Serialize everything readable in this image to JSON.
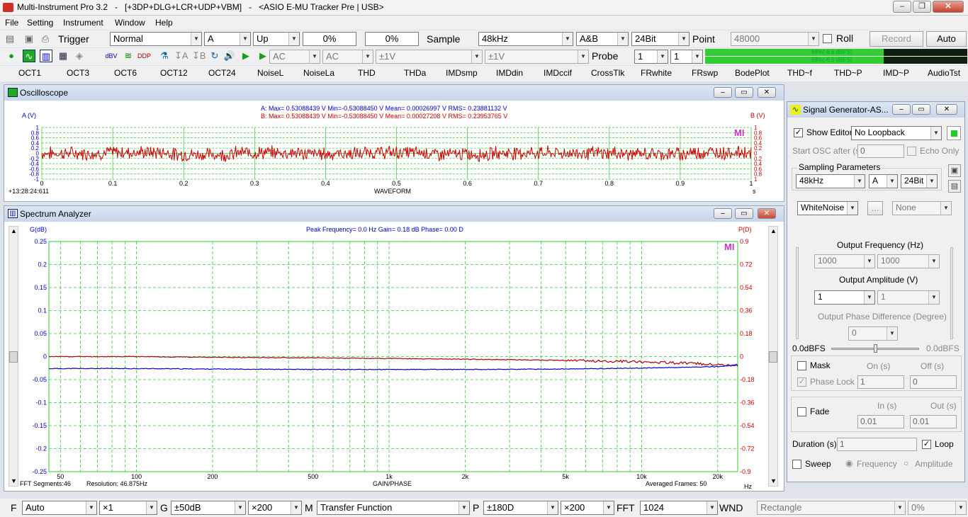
{
  "window_title": "Multi-Instrument Pro 3.2   -   [+3DP+DLG+LCR+UDP+VBM]   -   <ASIO E-MU Tracker Pre | USB>",
  "menu": [
    "File",
    "Setting",
    "Instrument",
    "Window",
    "Help"
  ],
  "toolbar1": {
    "trigger_label": "Trigger",
    "trigger_mode": "Normal",
    "channel": "A",
    "edge": "Up",
    "pct1": "0%",
    "pct2": "0%",
    "sample_label": "Sample",
    "sample_rate": "48kHz",
    "channels": "A&B",
    "bits": "24Bit",
    "point_label": "Point",
    "point_value": "48000",
    "roll_label": "Roll",
    "record_label": "Record",
    "auto_label": "Auto"
  },
  "toolbar2": {
    "coupling_a": "AC",
    "coupling_b": "AC",
    "range_a": "±1V",
    "range_b": "±1V",
    "probe_label": "Probe",
    "probe_a": "1",
    "probe_b": "1",
    "level_a": "68%(-6.6 dBFS)",
    "level_b": "68%(-6.6 dBFS)"
  },
  "function_buttons": [
    "OCT1",
    "OCT3",
    "OCT6",
    "OCT12",
    "OCT24",
    "NoiseL",
    "NoiseLa",
    "THD",
    "THDa",
    "IMDsmp",
    "IMDdin",
    "IMDccif",
    "CrossTlk",
    "FRwhite",
    "FRswp",
    "BodePlot",
    "THD~f",
    "THD~P",
    "IMD~P",
    "AudioTst"
  ],
  "oscilloscope": {
    "title": "Oscilloscope",
    "stats_a": "A:  Max= 0.53088439  V  Min=-0.53088450  V  Mean= 0.00026997  V  RMS= 0.23881132  V",
    "stats_b": "B:  Max= 0.53088439  V  Min=-0.53088450  V  Mean= 0.00027208  V  RMS= 0.23953765  V",
    "ylabel_a": "A (V)",
    "ylabel_b": "B (V)",
    "xlabel": "WAVEFORM",
    "timestamp": "+13:28:24:611",
    "x_unit": "s",
    "logo": "MI"
  },
  "spectrum": {
    "title": "Spectrum Analyzer",
    "ylabel_left": "G(dB)",
    "ylabel_right": "P(D)",
    "peak_info": "Peak Frequency= 0.0 Hz  Gain= 0.18 dB  Phase= 0.00 D",
    "xlabel": "GAIN/PHASE",
    "fft_segments": "FFT Segments:46",
    "resolution": "Resolution: 46.875Hz",
    "averaged": "Averaged Frames: 50",
    "x_unit": "Hz",
    "logo": "MI"
  },
  "chart_data": [
    {
      "type": "line",
      "title": "",
      "xlabel": "WAVEFORM",
      "ylabel": "A (V)",
      "y2label": "B (V)",
      "xlim": [
        0,
        1
      ],
      "ylim": [
        -1,
        1
      ],
      "x_ticks": [
        "0",
        "0.1",
        "0.2",
        "0.3",
        "0.4",
        "0.5",
        "0.6",
        "0.7",
        "0.8",
        "0.9",
        "1"
      ],
      "y_ticks": [
        "1",
        "0.8",
        "0.6",
        "0.4",
        "0.2",
        "0",
        "-0.2",
        "-0.4",
        "-0.6",
        "-0.8",
        "-1"
      ],
      "grid": true,
      "series": [
        {
          "name": "A",
          "color": "#0000ff",
          "values": [
            0.0,
            0.12,
            -0.15,
            0.08,
            -0.05,
            0.1,
            -0.12,
            0.06,
            0.02,
            -0.09,
            0.11,
            -0.07
          ]
        },
        {
          "name": "B",
          "color": "#cc0000",
          "values": [
            0.0,
            0.12,
            -0.15,
            0.08,
            -0.05,
            0.1,
            -0.12,
            0.06,
            0.02,
            -0.09,
            0.11,
            -0.07
          ]
        }
      ]
    },
    {
      "type": "line",
      "title": "",
      "xlabel": "GAIN/PHASE",
      "ylabel": "G(dB)",
      "y2label": "P(D)",
      "x_scale": "log",
      "xlim": [
        45,
        24000
      ],
      "ylim": [
        -0.25,
        0.25
      ],
      "y2lim": [
        -0.9,
        0.9
      ],
      "x_ticks": [
        "50",
        "100",
        "200",
        "500",
        "1k",
        "2k",
        "5k",
        "10k",
        "20k"
      ],
      "y_ticks": [
        "0.25",
        "0.2",
        "0.15",
        "0.1",
        "0.05",
        "0",
        "-0.05",
        "-0.1",
        "-0.15",
        "-0.2",
        "-0.25"
      ],
      "y2_ticks": [
        "0.9",
        "0.72",
        "0.54",
        "0.36",
        "0.18",
        "0",
        "-0.18",
        "-0.36",
        "-0.54",
        "-0.72",
        "-0.9"
      ],
      "grid": true,
      "series": [
        {
          "name": "Gain",
          "axis": "left",
          "color": "#0000cc",
          "x": [
            45,
            100,
            200,
            500,
            1000,
            2000,
            5000,
            10000,
            20000,
            24000
          ],
          "values": [
            -0.026,
            -0.026,
            -0.027,
            -0.028,
            -0.028,
            -0.028,
            -0.027,
            -0.025,
            -0.022,
            -0.018
          ]
        },
        {
          "name": "Phase",
          "axis": "right",
          "color": "#aa0000",
          "x": [
            45,
            100,
            200,
            500,
            1000,
            2000,
            5000,
            10000,
            20000,
            24000
          ],
          "values": [
            0.0,
            0.0,
            -0.005,
            -0.01,
            -0.015,
            -0.02,
            -0.03,
            -0.04,
            -0.06,
            -0.07
          ]
        }
      ]
    }
  ],
  "generator": {
    "title": "Signal Generator-AS...",
    "show_editor_label": "Show Editor",
    "loopback": "No Loopback",
    "start_osc_label": "Start OSC after (s)",
    "start_osc_value": "0",
    "echo_only_label": "Echo Only",
    "sampling_params_label": "Sampling Parameters",
    "sample_rate": "48kHz",
    "channel": "A",
    "bits": "24Bit",
    "waveform": "WhiteNoise",
    "ellipsis": "...",
    "none_option": "None",
    "output_freq_label": "Output Frequency (Hz)",
    "freq_a": "1000",
    "freq_b": "1000",
    "output_amp_label": "Output Amplitude (V)",
    "amp_a": "1",
    "amp_b": "1",
    "phase_diff_label": "Output Phase Difference (Degree)",
    "phase_value": "0",
    "dbfs_left": "0.0dBFS",
    "dbfs_right": "0.0dBFS",
    "mask_label": "Mask",
    "on_label": "On (s)",
    "off_label": "Off (s)",
    "phase_lock_label": "Phase Lock",
    "on_value": "1",
    "off_value": "0",
    "fade_label": "Fade",
    "in_label": "In (s)",
    "out_label": "Out (s)",
    "in_value": "0.01",
    "out_value": "0.01",
    "duration_label": "Duration (s)",
    "duration_value": "1",
    "loop_label": "Loop",
    "sweep_label": "Sweep",
    "frequency_label": "Frequency",
    "amplitude_label": "Amplitude"
  },
  "bottom": {
    "f_label": "F",
    "f_value": "Auto",
    "f_mult": "×1",
    "g_label": "G",
    "g_value": "±50dB",
    "g_mult": "×200",
    "m_label": "M",
    "m_value": "Transfer Function",
    "p_label": "P",
    "p_value": "±180D",
    "p_mult": "×200",
    "fft_label": "FFT",
    "fft_value": "1024",
    "wnd_label": "WND",
    "wnd_value": "Rectangle",
    "pct": "0%"
  }
}
